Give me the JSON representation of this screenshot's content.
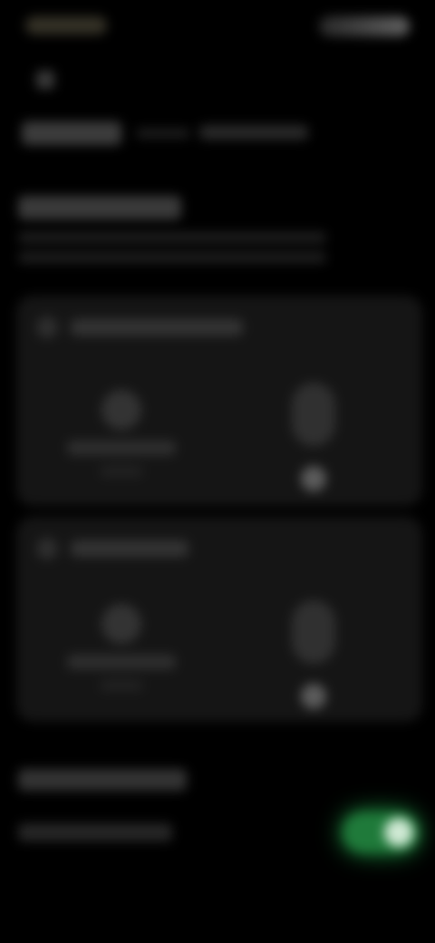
{
  "colors": {
    "background": "#000000",
    "card": "#151515",
    "toggle_on": "#1f7a3a",
    "toggle_glow": "#1d9a44"
  },
  "status_bar": {
    "time_icon": "clock-icon",
    "system_icons": "battery-wifi-icons"
  },
  "header": {
    "back_icon": "arrow-left-icon"
  },
  "cards": [
    {
      "header_icon": "person-icon",
      "left_avatar_icon": "avatar-icon",
      "right_control_icon": "slider-icon"
    },
    {
      "header_icon": "person-icon",
      "left_avatar_icon": "avatar-icon",
      "right_control_icon": "slider-icon"
    }
  ],
  "settings": {
    "toggle_state": true
  }
}
